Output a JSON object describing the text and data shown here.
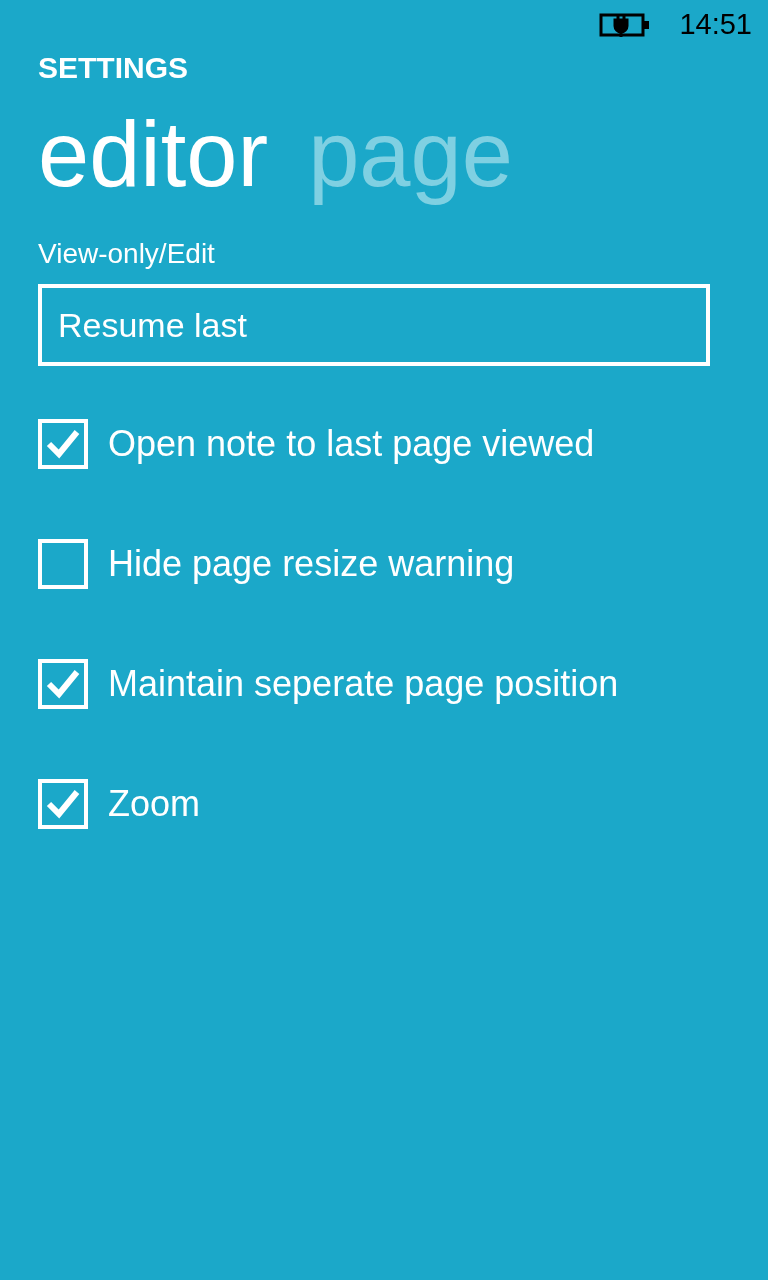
{
  "status_bar": {
    "time": "14:51"
  },
  "app_title": "SETTINGS",
  "pivots": [
    {
      "label": "editor",
      "selected": true
    },
    {
      "label": "page",
      "selected": false
    }
  ],
  "view_mode": {
    "label": "View-only/Edit",
    "value": "Resume last"
  },
  "options": [
    {
      "label": "Open note to last page viewed",
      "checked": true
    },
    {
      "label": "Hide page resize warning",
      "checked": false
    },
    {
      "label": "Maintain seperate page position",
      "checked": true
    },
    {
      "label": "Zoom",
      "checked": true
    }
  ]
}
